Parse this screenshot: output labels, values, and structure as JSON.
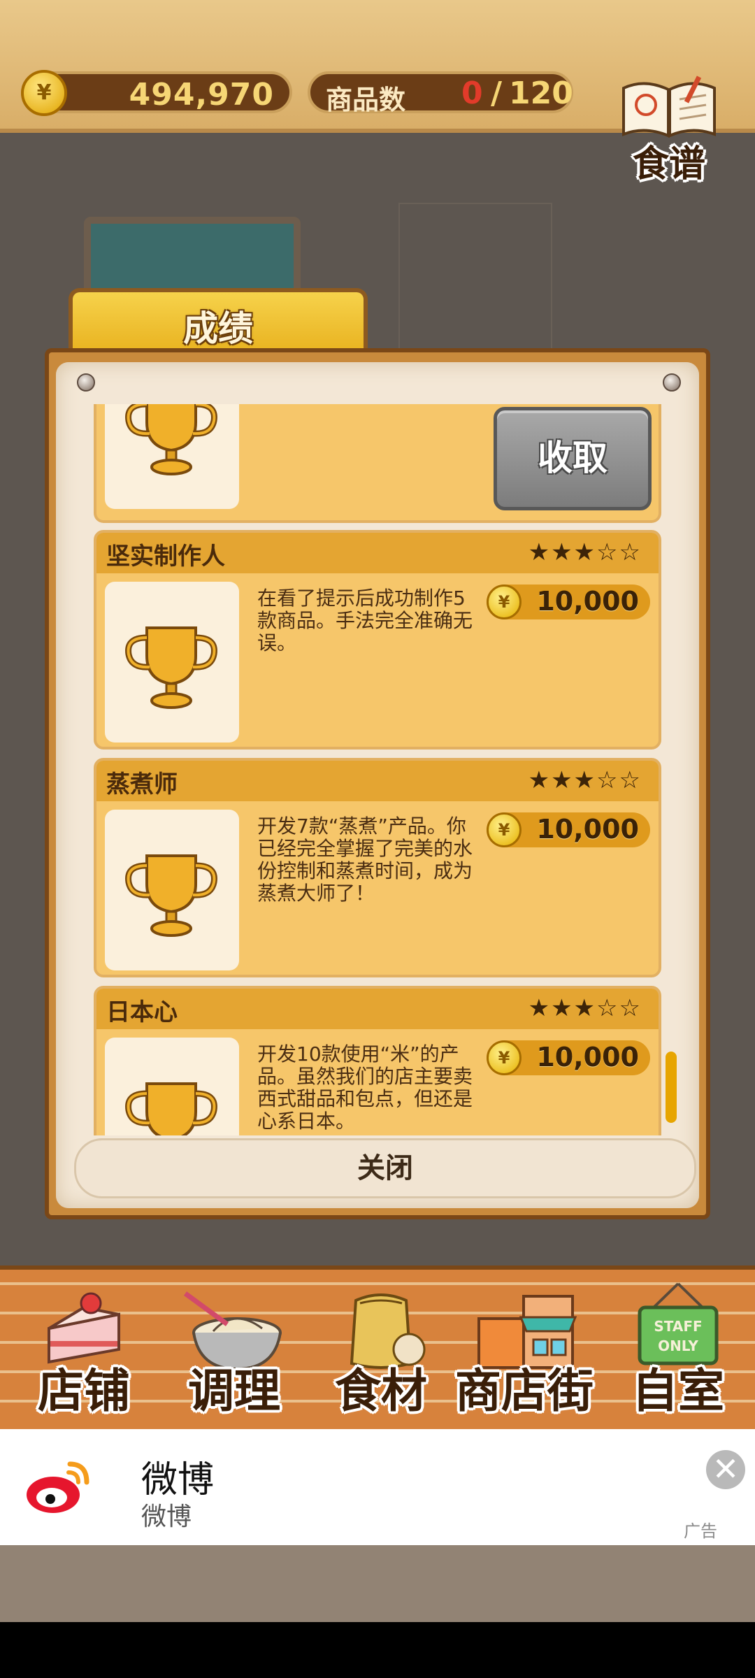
{
  "top": {
    "currency_symbol": "¥",
    "money": "494,970",
    "goods_label": "商品数",
    "goods_current": "0",
    "goods_separator": "/",
    "goods_max": "120",
    "recipe_label": "食谱"
  },
  "panel": {
    "tab_title": "成绩",
    "claim_label": "收取",
    "close_label": "关闭",
    "achievements": [
      {
        "title": "坚实制作人",
        "stars_filled": 3,
        "stars_total": 5,
        "stars": "★★★☆☆",
        "description": "在看了提示后成功制作5款商品。手法完全准确无误。",
        "reward": "10,000"
      },
      {
        "title": "蒸煮师",
        "stars_filled": 3,
        "stars_total": 5,
        "stars": "★★★☆☆",
        "description": "开发7款“蒸煮”产品。你已经完全掌握了完美的水份控制和蒸煮时间，成为蒸煮大师了！",
        "reward": "10,000"
      },
      {
        "title": "日本心",
        "stars_filled": 3,
        "stars_total": 5,
        "stars": "★★★☆☆",
        "description": "开发10款使用“米”的产品。虽然我们的店主要卖西式甜品和包点，但还是心系日本。",
        "reward": "10,000"
      }
    ]
  },
  "nav": {
    "items": [
      {
        "label": "店铺",
        "icon": "cake-icon"
      },
      {
        "label": "调理",
        "icon": "mixing-bowl-icon"
      },
      {
        "label": "食材",
        "icon": "flour-bag-icon"
      },
      {
        "label": "商店街",
        "icon": "shop-street-icon"
      },
      {
        "label": "自室",
        "icon": "staff-only-sign-icon"
      }
    ],
    "staff_sign": "STAFF ONLY"
  },
  "ad": {
    "title": "微博",
    "subtitle": "微博",
    "tag": "广告",
    "close_symbol": "✕"
  },
  "colors": {
    "accent_gold": "#e4a532",
    "card_bg": "#f6c66a",
    "money_text": "#f6d675",
    "goods_current": "#e23b2a"
  }
}
